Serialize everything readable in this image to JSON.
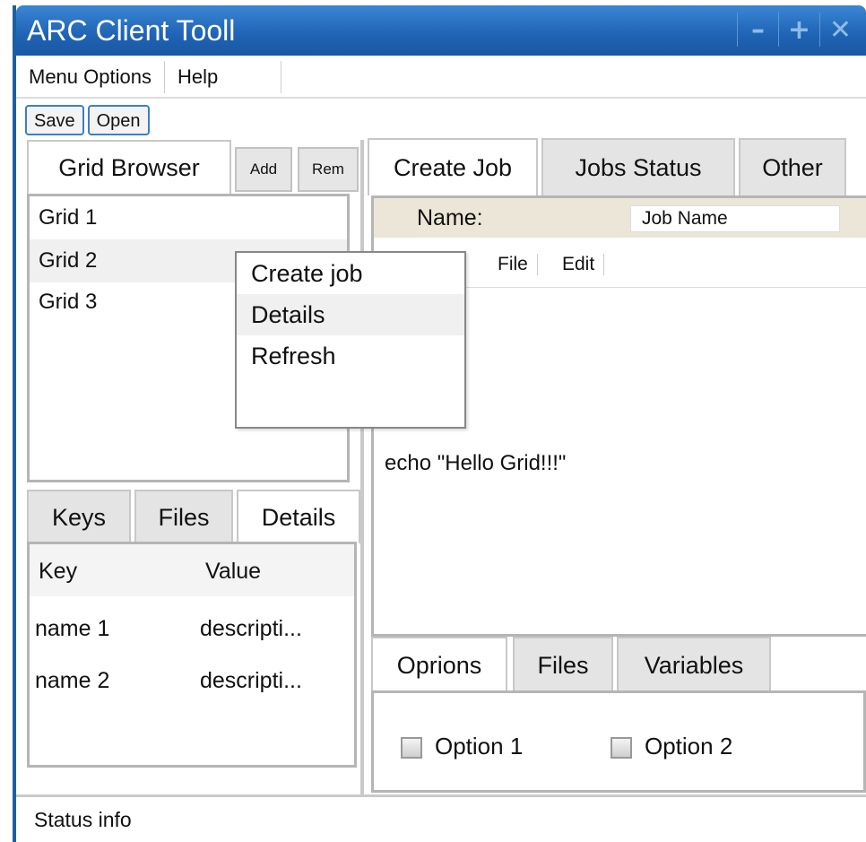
{
  "window": {
    "title": "ARC Client Tooll",
    "controls": [
      "minimize-icon",
      "maximize-icon",
      "close-icon"
    ]
  },
  "menubar": {
    "items": [
      "Menu Options",
      "Help"
    ]
  },
  "toolbar": {
    "save": "Save",
    "open": "Open"
  },
  "left": {
    "tab_grid_browser": "Grid Browser",
    "add": "Add",
    "rem": "Rem",
    "grids": [
      "Grid 1",
      "Grid 2",
      "Grid 3"
    ],
    "context_menu": [
      "Create job",
      "Details",
      "Refresh"
    ],
    "bottom_tabs": [
      "Keys",
      "Files",
      "Details"
    ],
    "table": {
      "headers": [
        "Key",
        "Value"
      ],
      "rows": [
        {
          "key": "name 1",
          "value": "descripti..."
        },
        {
          "key": "name 2",
          "value": "descripti..."
        }
      ]
    }
  },
  "right": {
    "tabs": [
      "Create Job",
      "Jobs Status",
      "Other"
    ],
    "name_label": "Name:",
    "name_value": "Job Name",
    "editor_menu": [
      "File",
      "Edit"
    ],
    "script": "echo \"Hello Grid!!!\"",
    "bottom_tabs": [
      "Oprions",
      "Files",
      "Variables"
    ],
    "options": [
      "Option 1",
      "Option 2"
    ]
  },
  "status": "Status info"
}
